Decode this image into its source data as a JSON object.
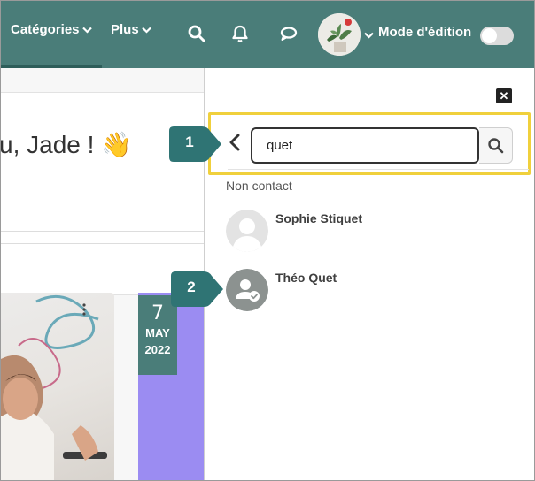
{
  "navbar": {
    "menu_categories": "Catégories",
    "menu_more": "Plus",
    "edit_mode_label": "Mode d'édition",
    "edit_mode_on": false
  },
  "main": {
    "greeting": "u, Jade ! 👋",
    "event": {
      "day": "7",
      "month": "MAY",
      "year": "2022"
    }
  },
  "drawer": {
    "search": {
      "value": "quet"
    },
    "section_label": "Non contact",
    "contacts": [
      {
        "name": "Sophie Stiquet",
        "avatar": "default-user-silhouette"
      },
      {
        "name": "Théo Quet",
        "avatar": "user-check-icon"
      }
    ]
  },
  "callouts": [
    "1",
    "2"
  ],
  "colors": {
    "navbar": "#4a7d79",
    "highlight": "#f0d03c",
    "callout": "#2f7474",
    "event_tile": "#9b8cf2"
  }
}
